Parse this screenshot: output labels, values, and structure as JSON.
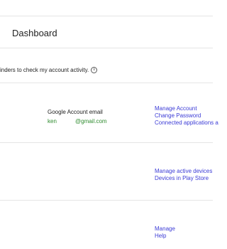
{
  "header": {
    "title": "Dashboard"
  },
  "reminder": {
    "text": "inders to check my account activity.",
    "icon": "info-icon"
  },
  "account_section": {
    "email_label": "Google Account email",
    "email_user": "ken",
    "email_domain": "@gmail.com",
    "links": [
      "Manage Account",
      "Change Password",
      "Connected applications a"
    ]
  },
  "devices_section": {
    "links": [
      "Manage active devices",
      "Devices in Play Store"
    ]
  },
  "third_section": {
    "links": [
      "Manage",
      "Help"
    ]
  }
}
